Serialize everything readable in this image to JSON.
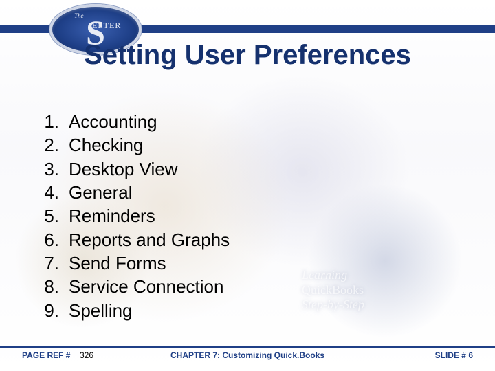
{
  "title": "Setting User Preferences",
  "list": [
    "Accounting",
    "Checking",
    "Desktop View",
    "General",
    "Reminders",
    "Reports and Graphs",
    "Send Forms",
    "Service Connection",
    "Spelling"
  ],
  "bgcaption": {
    "line1": "Learning",
    "line2": "QuickBooks",
    "line3": "Step-by-Step"
  },
  "logo": {
    "the": "The",
    "s": "S",
    "rest": "EETER"
  },
  "footer": {
    "pageref_label": "PAGE REF #",
    "pageref_value": "326",
    "chapter": "CHAPTER 7: Customizing Quick.Books",
    "slide_label": "SLIDE #",
    "slide_value": "6"
  }
}
